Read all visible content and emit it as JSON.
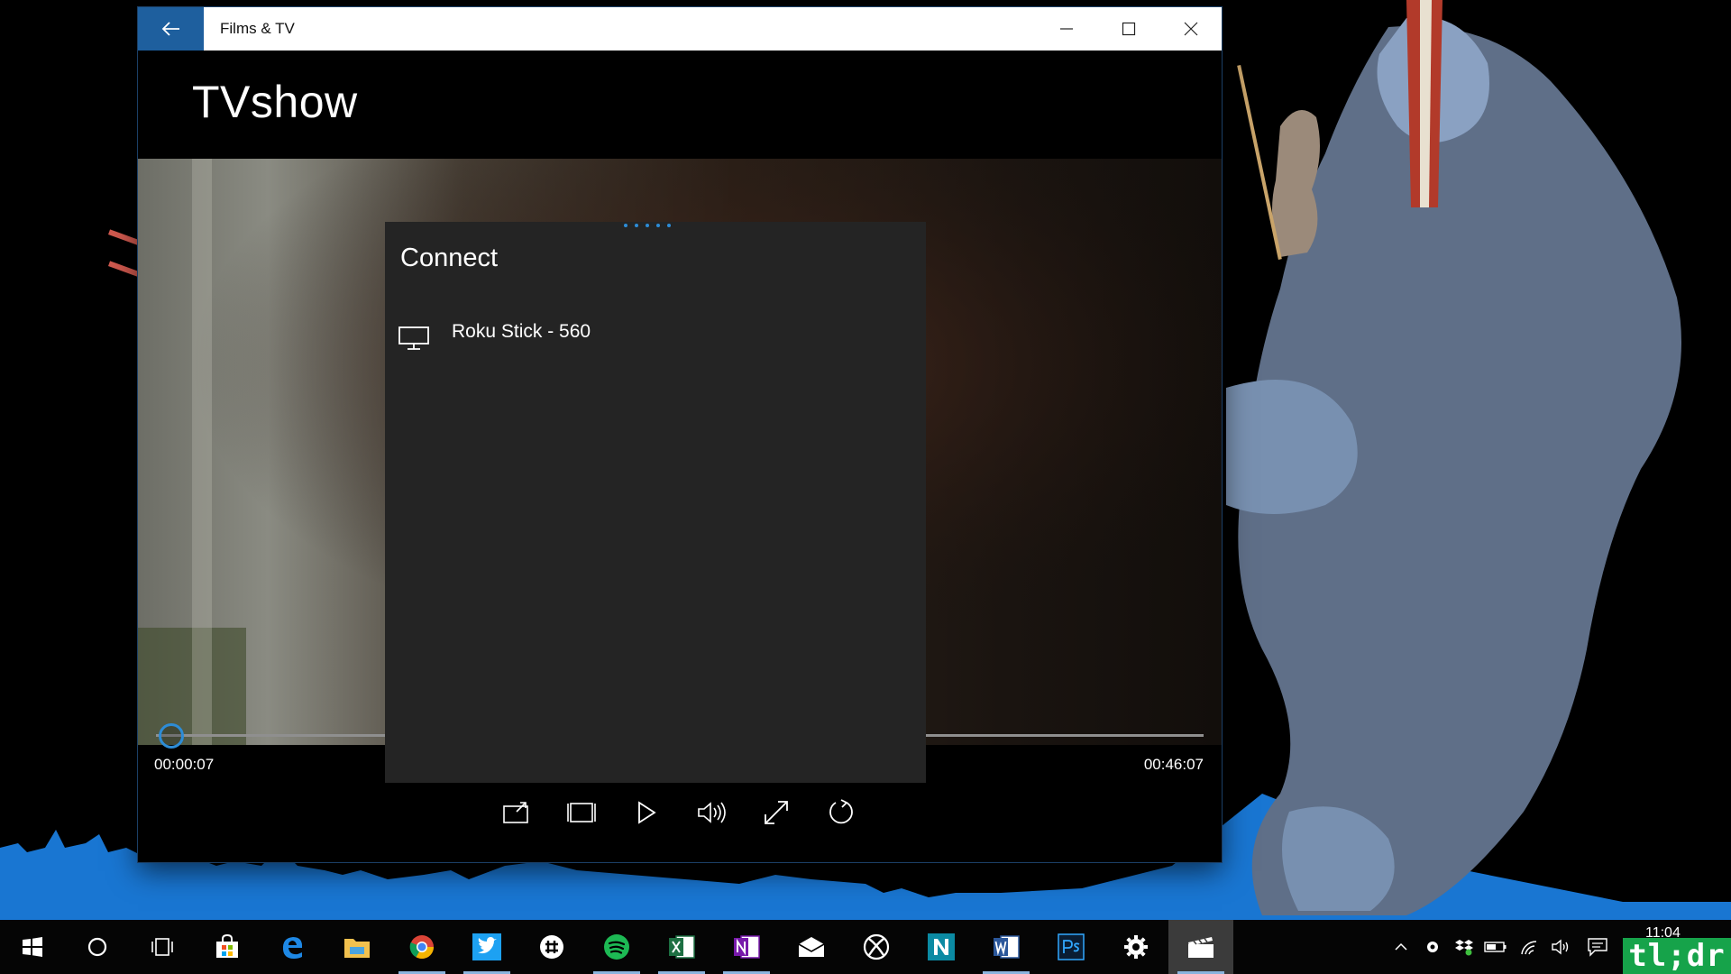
{
  "window": {
    "title": "Films & TV",
    "page_title": "TVshow"
  },
  "player": {
    "time_current": "00:00:07",
    "time_total": "00:46:07",
    "progress_fraction": 0.0025,
    "controls": [
      "cast-icon",
      "aspect-ratio-icon",
      "play-icon",
      "volume-icon",
      "fullscreen-icon",
      "repeat-icon"
    ]
  },
  "connect": {
    "title": "Connect",
    "devices": [
      {
        "name": "Roku Stick - 560",
        "icon": "monitor-icon"
      }
    ]
  },
  "taskbar": {
    "apps": [
      "start",
      "search",
      "task-view",
      "store",
      "edge",
      "file-explorer",
      "chrome",
      "twitter",
      "slack",
      "spotify",
      "excel",
      "onenote",
      "mail",
      "xbox",
      "news",
      "word",
      "photoshop",
      "settings",
      "films-tv"
    ],
    "active_app": "films-tv",
    "clock": "11:04"
  },
  "watermark": "tl;dr",
  "colors": {
    "accent": "#1e5f9e",
    "seek_accent": "#2d8cd6",
    "panel_bg": "#242424",
    "skyline": "#1976d2"
  }
}
